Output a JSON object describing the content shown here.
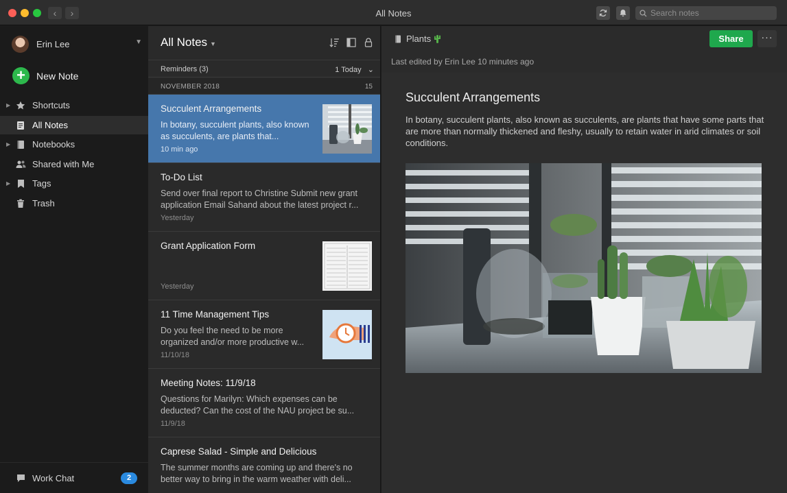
{
  "window": {
    "title": "All Notes"
  },
  "search": {
    "placeholder": "Search notes"
  },
  "sidebar": {
    "user_name": "Erin Lee",
    "new_note_label": "New Note",
    "items": [
      {
        "label": "Shortcuts",
        "icon": "star-icon"
      },
      {
        "label": "All Notes",
        "icon": "note-icon"
      },
      {
        "label": "Notebooks",
        "icon": "notebook-icon"
      },
      {
        "label": "Shared with Me",
        "icon": "people-icon"
      },
      {
        "label": "Tags",
        "icon": "tag-icon"
      },
      {
        "label": "Trash",
        "icon": "trash-icon"
      }
    ],
    "work_chat": {
      "label": "Work Chat",
      "badge": "2"
    }
  },
  "note_list": {
    "title": "All Notes",
    "reminders_label": "Reminders (3)",
    "reminders_today": "1 Today",
    "month_label": "NOVEMBER 2018",
    "month_count": "15",
    "notes": [
      {
        "title": "Succulent Arrangements",
        "snippet": "In botany, succulent plants, also known as succulents, are plants that...",
        "date": "10 min ago"
      },
      {
        "title": "To-Do List",
        "snippet": "Send over final report to Christine Submit new grant application Email Sahand about the latest project r...",
        "date": "Yesterday"
      },
      {
        "title": "Grant Application Form",
        "snippet": "",
        "date": "Yesterday"
      },
      {
        "title": "11 Time Management Tips",
        "snippet": "Do you feel the need to be more organized and/or more productive w...",
        "date": "11/10/18"
      },
      {
        "title": "Meeting Notes: 11/9/18",
        "snippet": "Questions for Marilyn: Which expenses can be deducted? Can the cost of the NAU project be su...",
        "date": "11/9/18"
      },
      {
        "title": "Caprese Salad - Simple and Delicious",
        "snippet": "The summer months are coming up and there's no better way to bring in the warm weather with deli...",
        "date": ""
      }
    ]
  },
  "editor": {
    "notebook": "Plants",
    "share_label": "Share",
    "more_label": "···",
    "last_edited": "Last edited by Erin Lee 10 minutes ago",
    "title": "Succulent Arrangements",
    "body": "In botany, succulent plants, also known as succulents, are plants that have some parts that are more than normally thickened and fleshy, usually to retain water in arid climates or soil conditions."
  },
  "colors": {
    "accent_green": "#1fa84d",
    "selection_blue": "#4677ac",
    "badge_blue": "#2a8adf"
  }
}
